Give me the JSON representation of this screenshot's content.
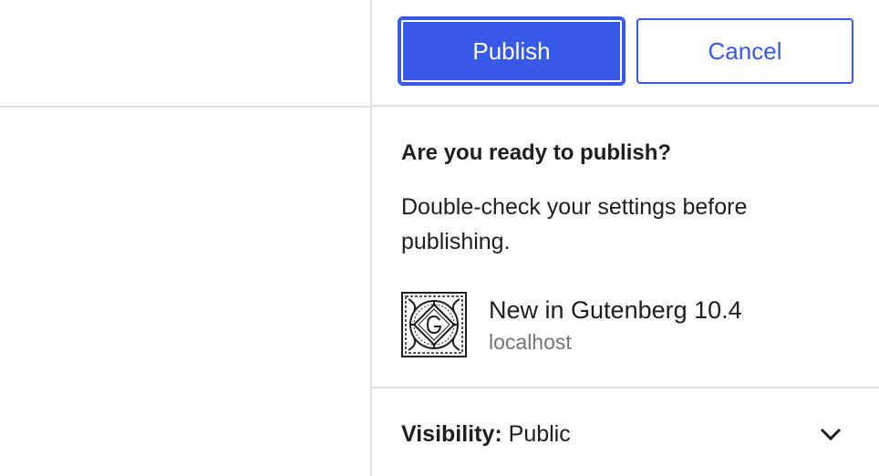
{
  "header": {
    "publish_label": "Publish",
    "cancel_label": "Cancel"
  },
  "prepublish": {
    "title": "Are you ready to publish?",
    "description": "Double-check your settings before publishing."
  },
  "site": {
    "name": "New in Gutenberg 10.4",
    "home": "localhost",
    "icon": "gutenberg-ornate-logo"
  },
  "visibility": {
    "label": "Visibility:",
    "value": "Public",
    "toggle_icon": "chevron-down-icon"
  },
  "colors": {
    "accent": "#3858e9",
    "border": "#e0e0e0",
    "muted_text": "#757575"
  }
}
